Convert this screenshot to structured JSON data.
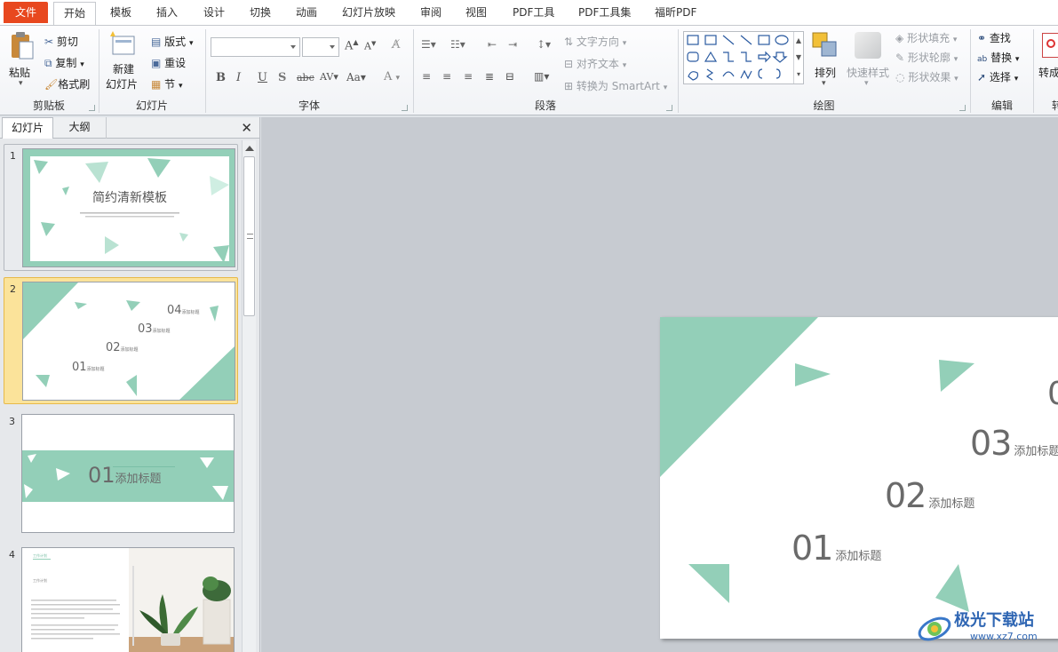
{
  "tabs": [
    "文件",
    "开始",
    "模板",
    "插入",
    "设计",
    "切换",
    "动画",
    "幻灯片放映",
    "审阅",
    "视图",
    "PDF工具",
    "PDF工具集",
    "福昕PDF"
  ],
  "ribbon": {
    "clipboard": {
      "paste": "粘贴",
      "cut": "剪切",
      "copy": "复制",
      "format_painter": "格式刷",
      "label": "剪贴板"
    },
    "slides": {
      "new_slide_1": "新建",
      "new_slide_2": "幻灯片",
      "layout": "版式",
      "reset": "重设",
      "section": "节",
      "label": "幻灯片"
    },
    "font": {
      "label": "字体"
    },
    "paragraph": {
      "text_direction": "文字方向",
      "align_text": "对齐文本",
      "smartart": "转换为 SmartArt",
      "label": "段落"
    },
    "drawing": {
      "arrange": "排列",
      "quick_styles": "快速样式",
      "shape_fill": "形状填充",
      "shape_outline": "形状轮廓",
      "shape_effects": "形状效果",
      "label": "绘图"
    },
    "editing": {
      "find": "查找",
      "replace": "替换",
      "select": "选择",
      "label": "编辑"
    },
    "convert": {
      "label_top": "转成",
      "label_bottom": "转"
    }
  },
  "pane": {
    "tab_slides": "幻灯片",
    "tab_outline": "大纲",
    "close": "✕"
  },
  "thumbnails": [
    {
      "num": "1",
      "title": "简约清新模板"
    },
    {
      "num": "2",
      "items": [
        {
          "n": "04",
          "t": "添加标题"
        },
        {
          "n": "03",
          "t": "添加标题"
        },
        {
          "n": "02",
          "t": "添加标题"
        },
        {
          "n": "01",
          "t": "添加标题"
        }
      ]
    },
    {
      "num": "3",
      "num_text": "01",
      "title": "添加标题"
    },
    {
      "num": "4",
      "heading": "工作计划",
      "sub": "工作计划"
    }
  ],
  "main_slide": {
    "items": [
      {
        "n": "03",
        "t": "添加标题"
      },
      {
        "n": "02",
        "t": "添加标题"
      },
      {
        "n": "01",
        "t": "添加标题"
      }
    ]
  },
  "watermark": {
    "text": "极光下载站",
    "url": "www.xz7.com"
  },
  "colors": {
    "accent_mint": "#93cfb8",
    "file_tab": "#e8481f",
    "selected_slide": "#f7d36a"
  }
}
